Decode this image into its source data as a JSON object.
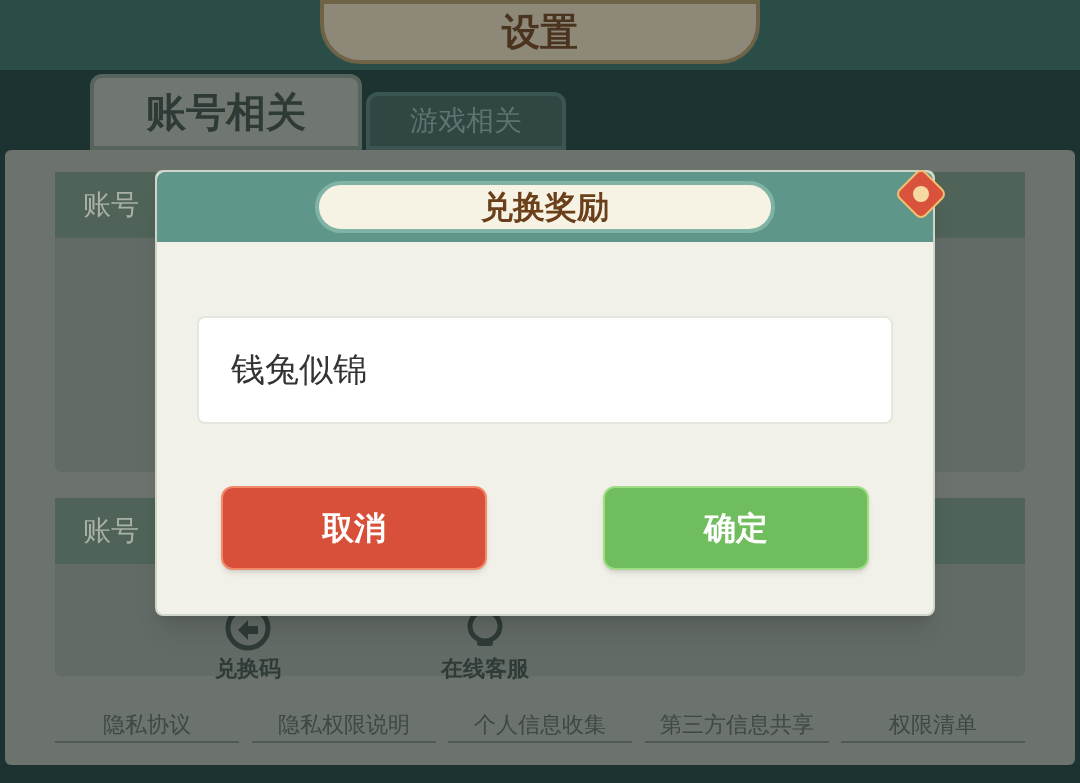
{
  "title": "设置",
  "tabs": [
    {
      "label": "账号相关",
      "selected": true
    },
    {
      "label": "游戏相关",
      "selected": false
    }
  ],
  "sections": [
    {
      "header": "账号"
    },
    {
      "header": "账号",
      "shortcuts": [
        {
          "label": "兑换码",
          "kind": "code"
        },
        {
          "label": "在线客服",
          "kind": "service"
        }
      ]
    }
  ],
  "links": [
    "隐私协议",
    "隐私权限说明",
    "个人信息收集",
    "第三方信息共享",
    "权限清单"
  ],
  "dialog": {
    "title": "兑换奖励",
    "input": {
      "value": "钱兔似锦"
    },
    "buttons": [
      {
        "label": "取消",
        "kind": "cancel"
      },
      {
        "label": "确定",
        "kind": "confirm"
      }
    ]
  }
}
